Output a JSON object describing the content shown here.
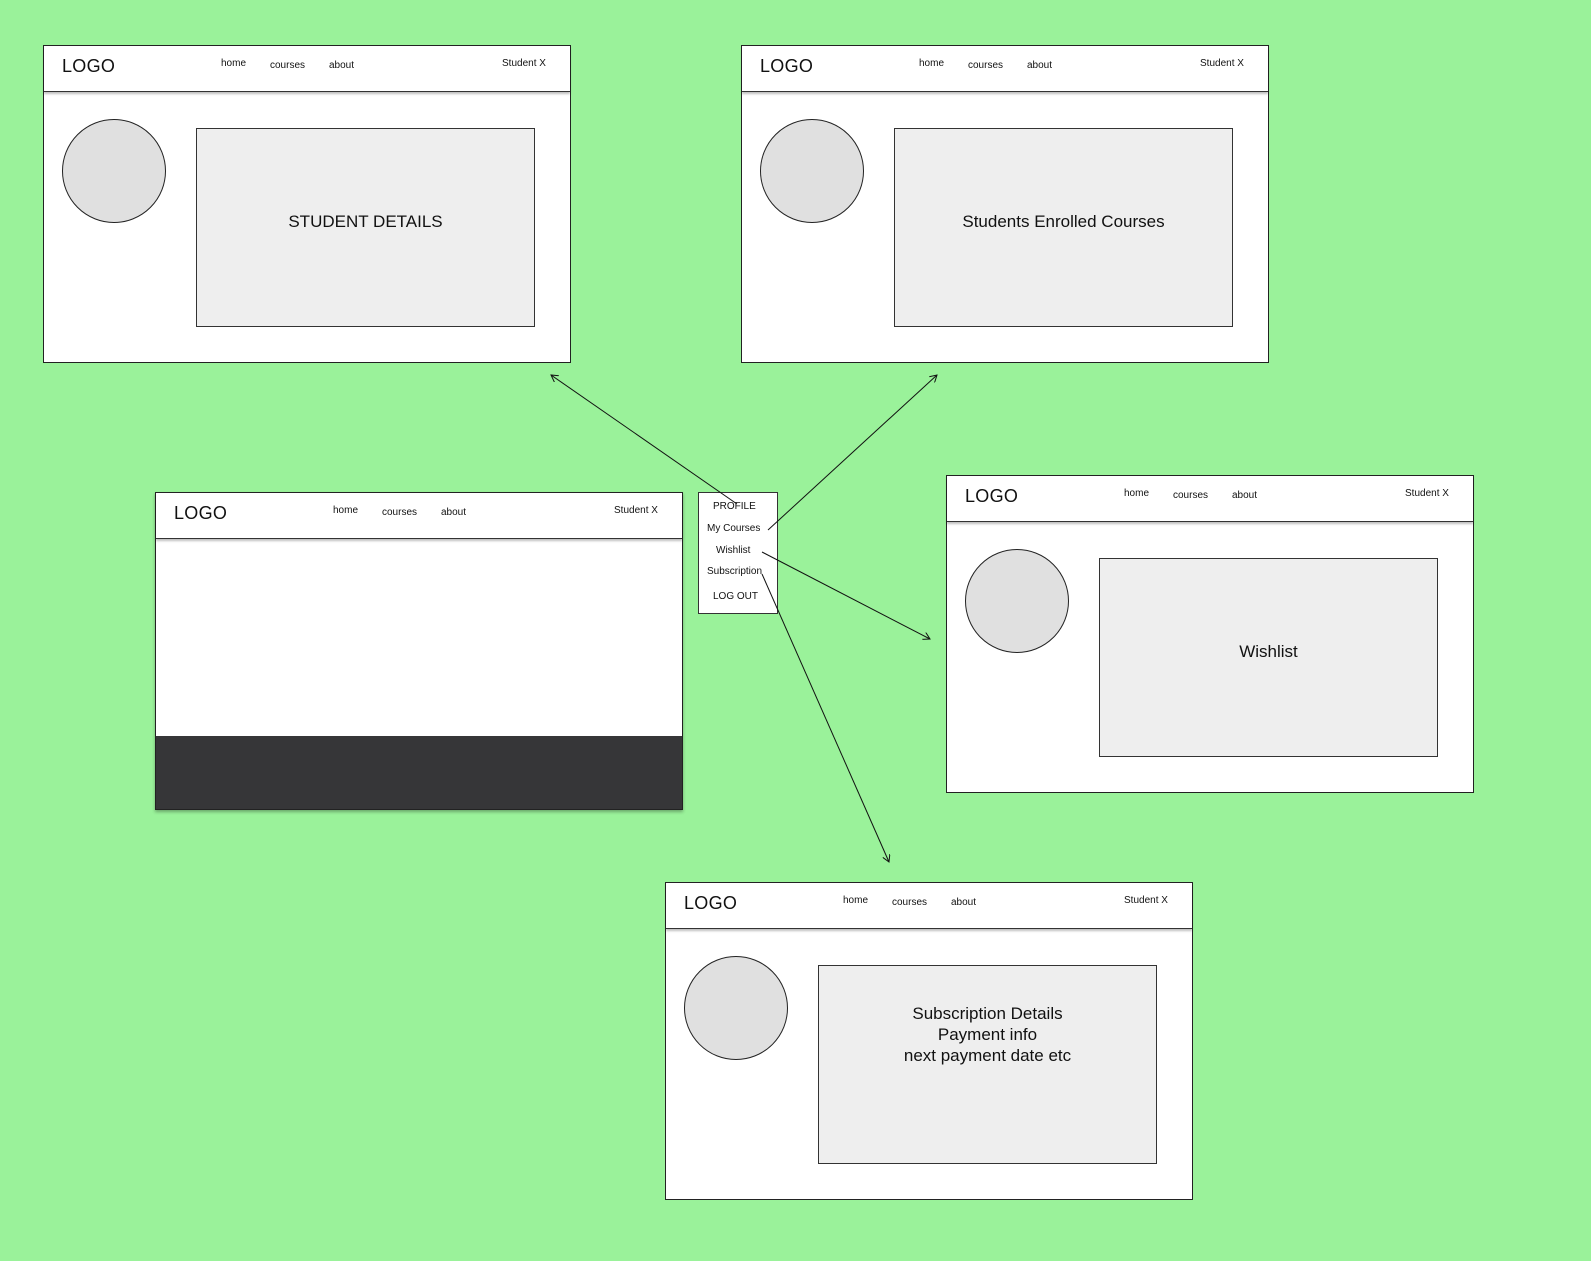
{
  "wireframe": {
    "logo": "LOGO",
    "nav": {
      "home": "home",
      "courses": "courses",
      "about": "about"
    },
    "user": "Student X"
  },
  "screens": {
    "profile": {
      "panel_text": "STUDENT DETAILS"
    },
    "my_courses": {
      "panel_text": "Students Enrolled Courses"
    },
    "wishlist": {
      "panel_text": "Wishlist"
    },
    "subscription": {
      "panel_text": "Subscription Details\nPayment info\nnext payment date etc"
    }
  },
  "menu": {
    "profile": "PROFILE",
    "my_courses": "My Courses",
    "wishlist": "Wishlist",
    "subscription": "Subscription",
    "logout": "LOG OUT"
  },
  "colors": {
    "background": "#9af29a",
    "panel": "#eeeeee",
    "avatar": "#e0e0e0",
    "footer": "#363638"
  }
}
